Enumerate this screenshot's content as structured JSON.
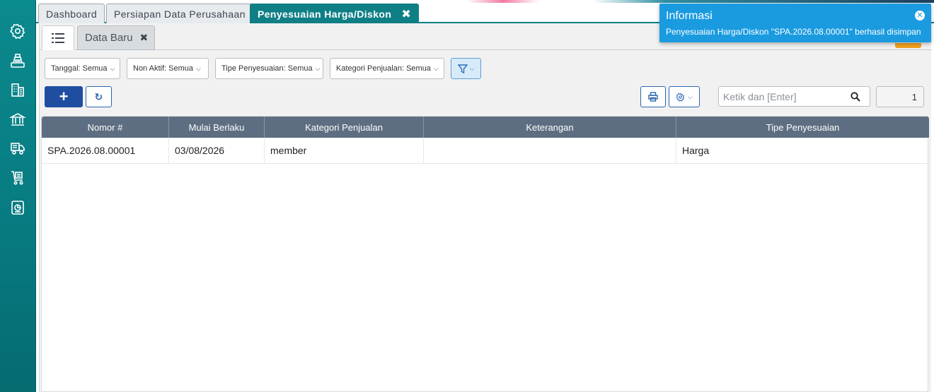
{
  "tabs": [
    {
      "label": "Dashboard"
    },
    {
      "label": "Persiapan Data Perusahaan"
    },
    {
      "label": "Penyesuaian Harga/Diskon",
      "close": "✖"
    }
  ],
  "subtabs": {
    "new_label": "Data Baru",
    "close": "✖"
  },
  "filters": [
    {
      "label": "Tanggal: Semua"
    },
    {
      "label": "Non Aktif: Semua"
    },
    {
      "label": "Tipe Penyesuaian: Semua"
    },
    {
      "label": "Kategori Penjualan: Semua"
    }
  ],
  "toolbar": {
    "add_label": "+",
    "refresh_label": "↻",
    "search_placeholder": "Ketik dan [Enter]",
    "page_number": "1"
  },
  "table": {
    "columns": [
      "Nomor #",
      "Mulai Berlaku",
      "Kategori Penjualan",
      "Keterangan",
      "Tipe Penyesuaian"
    ],
    "rows": [
      [
        "SPA.2026.08.00001",
        "03/08/2026",
        "member",
        "",
        "Harga"
      ]
    ]
  },
  "notification": {
    "title": "Informasi",
    "message": "Penyesuaian Harga/Diskon \"SPA.2026.08.00001\" berhasil disimpan"
  },
  "colors": {
    "sidebar": "#0b8a8e",
    "active_tab": "#0f7f86",
    "table_header": "#5e6e82",
    "primary_button": "#1f4ea0",
    "notification": "#1a9be0"
  },
  "icons": {
    "sidebar": [
      "gear-icon",
      "cash-register-icon",
      "building-icon",
      "bank-icon",
      "truck-icon",
      "cart-icon",
      "report-icon"
    ]
  }
}
